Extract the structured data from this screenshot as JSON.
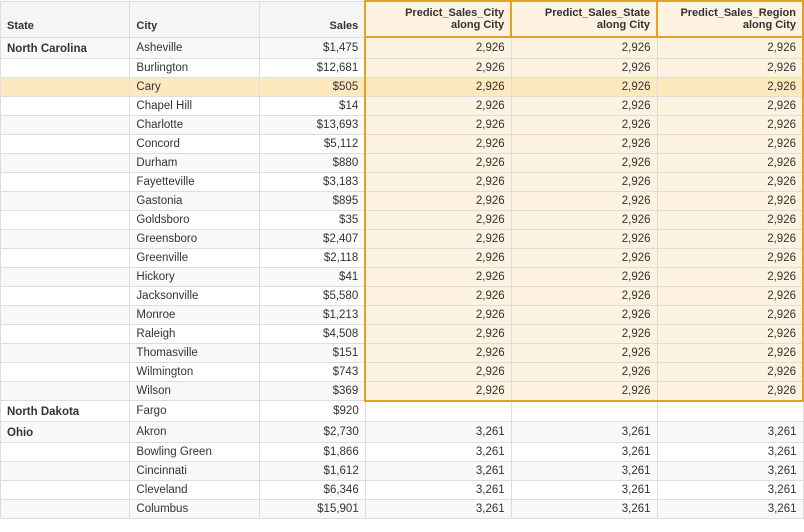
{
  "columns": {
    "state": "State",
    "city": "City",
    "sales": "Sales",
    "predict1": "Predict_Sales_City\nalong City",
    "predict2": "Predict_Sales_State\nalong City",
    "predict3": "Predict_Sales_Region\nalong City"
  },
  "rows": [
    {
      "state": "North Carolina",
      "city": "Asheville",
      "sales": "$1,475",
      "p1": "2,926",
      "p2": "2,926",
      "p3": "2,926",
      "stateFirst": true,
      "highlight": false,
      "nc": true
    },
    {
      "state": "",
      "city": "Burlington",
      "sales": "$12,681",
      "p1": "2,926",
      "p2": "2,926",
      "p3": "2,926",
      "stateFirst": false,
      "highlight": false,
      "nc": true
    },
    {
      "state": "",
      "city": "Cary",
      "sales": "$505",
      "p1": "2,926",
      "p2": "2,926",
      "p3": "2,926",
      "stateFirst": false,
      "highlight": true,
      "nc": true
    },
    {
      "state": "",
      "city": "Chapel Hill",
      "sales": "$14",
      "p1": "2,926",
      "p2": "2,926",
      "p3": "2,926",
      "stateFirst": false,
      "highlight": false,
      "nc": true
    },
    {
      "state": "",
      "city": "Charlotte",
      "sales": "$13,693",
      "p1": "2,926",
      "p2": "2,926",
      "p3": "2,926",
      "stateFirst": false,
      "highlight": false,
      "nc": true
    },
    {
      "state": "",
      "city": "Concord",
      "sales": "$5,112",
      "p1": "2,926",
      "p2": "2,926",
      "p3": "2,926",
      "stateFirst": false,
      "highlight": false,
      "nc": true
    },
    {
      "state": "",
      "city": "Durham",
      "sales": "$880",
      "p1": "2,926",
      "p2": "2,926",
      "p3": "2,926",
      "stateFirst": false,
      "highlight": false,
      "nc": true
    },
    {
      "state": "",
      "city": "Fayetteville",
      "sales": "$3,183",
      "p1": "2,926",
      "p2": "2,926",
      "p3": "2,926",
      "stateFirst": false,
      "highlight": false,
      "nc": true
    },
    {
      "state": "",
      "city": "Gastonia",
      "sales": "$895",
      "p1": "2,926",
      "p2": "2,926",
      "p3": "2,926",
      "stateFirst": false,
      "highlight": false,
      "nc": true
    },
    {
      "state": "",
      "city": "Goldsboro",
      "sales": "$35",
      "p1": "2,926",
      "p2": "2,926",
      "p3": "2,926",
      "stateFirst": false,
      "highlight": false,
      "nc": true
    },
    {
      "state": "",
      "city": "Greensboro",
      "sales": "$2,407",
      "p1": "2,926",
      "p2": "2,926",
      "p3": "2,926",
      "stateFirst": false,
      "highlight": false,
      "nc": true
    },
    {
      "state": "",
      "city": "Greenville",
      "sales": "$2,118",
      "p1": "2,926",
      "p2": "2,926",
      "p3": "2,926",
      "stateFirst": false,
      "highlight": false,
      "nc": true
    },
    {
      "state": "",
      "city": "Hickory",
      "sales": "$41",
      "p1": "2,926",
      "p2": "2,926",
      "p3": "2,926",
      "stateFirst": false,
      "highlight": false,
      "nc": true
    },
    {
      "state": "",
      "city": "Jacksonville",
      "sales": "$5,580",
      "p1": "2,926",
      "p2": "2,926",
      "p3": "2,926",
      "stateFirst": false,
      "highlight": false,
      "nc": true
    },
    {
      "state": "",
      "city": "Monroe",
      "sales": "$1,213",
      "p1": "2,926",
      "p2": "2,926",
      "p3": "2,926",
      "stateFirst": false,
      "highlight": false,
      "nc": true
    },
    {
      "state": "",
      "city": "Raleigh",
      "sales": "$4,508",
      "p1": "2,926",
      "p2": "2,926",
      "p3": "2,926",
      "stateFirst": false,
      "highlight": false,
      "nc": true
    },
    {
      "state": "",
      "city": "Thomasville",
      "sales": "$151",
      "p1": "2,926",
      "p2": "2,926",
      "p3": "2,926",
      "stateFirst": false,
      "highlight": false,
      "nc": true
    },
    {
      "state": "",
      "city": "Wilmington",
      "sales": "$743",
      "p1": "2,926",
      "p2": "2,926",
      "p3": "2,926",
      "stateFirst": false,
      "highlight": false,
      "nc": true
    },
    {
      "state": "",
      "city": "Wilson",
      "sales": "$369",
      "p1": "2,926",
      "p2": "2,926",
      "p3": "2,926",
      "stateFirst": false,
      "highlight": false,
      "nc": true,
      "ncLast": true
    },
    {
      "state": "North Dakota",
      "city": "Fargo",
      "sales": "$920",
      "p1": "",
      "p2": "",
      "p3": "",
      "stateFirst": true,
      "highlight": false,
      "nc": false
    },
    {
      "state": "Ohio",
      "city": "Akron",
      "sales": "$2,730",
      "p1": "3,261",
      "p2": "3,261",
      "p3": "3,261",
      "stateFirst": true,
      "highlight": false,
      "nc": false
    },
    {
      "state": "",
      "city": "Bowling Green",
      "sales": "$1,866",
      "p1": "3,261",
      "p2": "3,261",
      "p3": "3,261",
      "stateFirst": false,
      "highlight": false,
      "nc": false
    },
    {
      "state": "",
      "city": "Cincinnati",
      "sales": "$1,612",
      "p1": "3,261",
      "p2": "3,261",
      "p3": "3,261",
      "stateFirst": false,
      "highlight": false,
      "nc": false
    },
    {
      "state": "",
      "city": "Cleveland",
      "sales": "$6,346",
      "p1": "3,261",
      "p2": "3,261",
      "p3": "3,261",
      "stateFirst": false,
      "highlight": false,
      "nc": false
    },
    {
      "state": "",
      "city": "Columbus",
      "sales": "$15,901",
      "p1": "3,261",
      "p2": "3,261",
      "p3": "3,261",
      "stateFirst": false,
      "highlight": false,
      "nc": false
    }
  ]
}
